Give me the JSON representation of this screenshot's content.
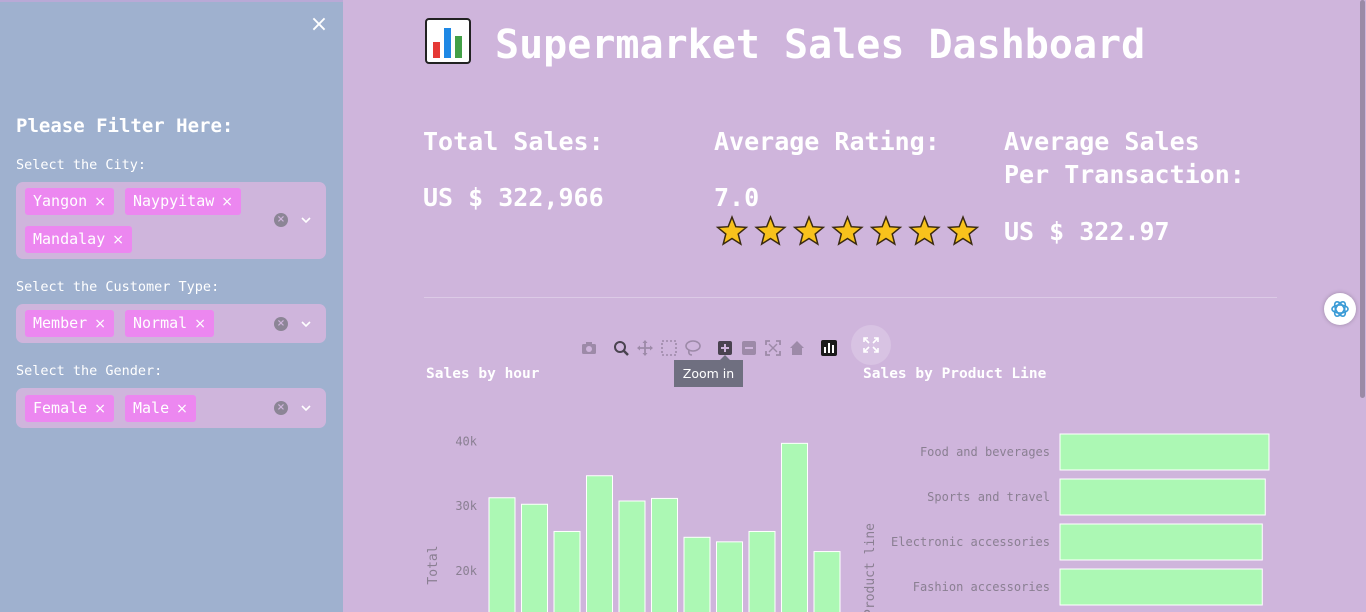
{
  "sidebar": {
    "close_symbol": "×",
    "heading": "Please Filter Here:",
    "filters": [
      {
        "label": "Select the City:",
        "values": [
          "Yangon",
          "Naypyitaw",
          "Mandalay"
        ]
      },
      {
        "label": "Select the Customer Type:",
        "values": [
          "Member",
          "Normal"
        ]
      },
      {
        "label": "Select the Gender:",
        "values": [
          "Female",
          "Male"
        ]
      }
    ]
  },
  "header": {
    "icon": "bar-chart-emoji-icon",
    "title": "Supermarket Sales Dashboard"
  },
  "kpis": {
    "total_sales_label": "Total Sales:",
    "total_sales_value": "US $ 322,966",
    "avg_rating_label": "Average Rating:",
    "avg_rating_value": "7.0",
    "avg_rating_stars": 7,
    "avg_sale_label_line1": "Average Sales",
    "avg_sale_label_line2": "Per Transaction:",
    "avg_sale_value": "US $ 322.97"
  },
  "modebar": {
    "buttons": [
      "camera-icon",
      "zoom-icon",
      "pan-icon",
      "box-select-icon",
      "lasso-select-icon",
      "zoom-in-icon",
      "zoom-out-icon",
      "autoscale-icon",
      "reset-axes-icon",
      "plotly-logo-icon"
    ],
    "tooltip": "Zoom in"
  },
  "colors": {
    "bar": "#acf8b4",
    "sidebar": "#9fb1cf",
    "background": "#cfb5dc",
    "tag": "#ec87f0"
  },
  "chart_data": [
    {
      "type": "bar",
      "title": "Sales by hour",
      "ylabel": "Total",
      "y_ticks": [
        "20k",
        "30k",
        "40k"
      ],
      "values": [
        31300,
        30300,
        26100,
        34700,
        30800,
        31200,
        25200,
        24500,
        26100,
        39700,
        23000
      ]
    },
    {
      "type": "bar",
      "orientation": "horizontal",
      "title": "Sales by Product Line",
      "ylabel": "Product line",
      "categories": [
        "Food and beverages",
        "Sports and travel",
        "Electronic accessories",
        "Fashion accessories"
      ],
      "values": [
        56100,
        55100,
        54300,
        54300
      ]
    }
  ]
}
